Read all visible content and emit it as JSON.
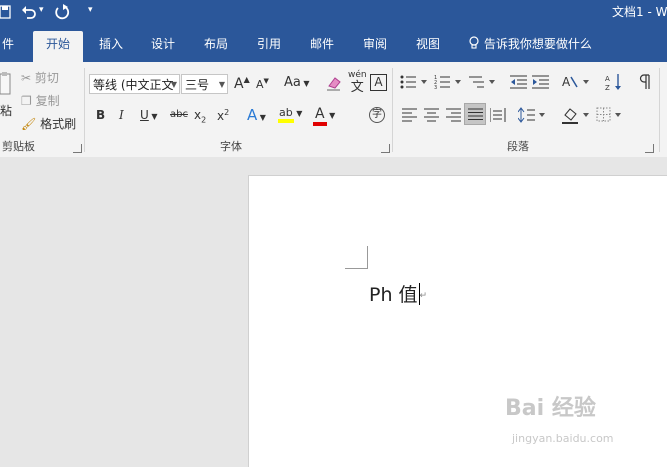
{
  "titlebar": {
    "title": "文档1 - W",
    "undo_arrow": "▾",
    "qat_more": "▾"
  },
  "tabs": [
    {
      "label": "件"
    },
    {
      "label": "开始",
      "active": true
    },
    {
      "label": "插入"
    },
    {
      "label": "设计"
    },
    {
      "label": "布局"
    },
    {
      "label": "引用"
    },
    {
      "label": "邮件"
    },
    {
      "label": "审阅"
    },
    {
      "label": "视图"
    }
  ],
  "tell_me": {
    "label": "告诉我你想要做什么"
  },
  "clipboard": {
    "paste_label": "粘",
    "cut": "剪切",
    "copy": "复制",
    "format_painter": "格式刷",
    "group_label": "剪贴板"
  },
  "font": {
    "font_name": "等线 (中文正文",
    "font_size": "三号",
    "grow": "A",
    "shrink": "A",
    "change_case": "Aa",
    "phonetic_top": "wén",
    "phonetic_bottom": "文",
    "border_char": "A",
    "bold": "B",
    "italic": "I",
    "underline": "U",
    "strikethrough": "abc",
    "subscript": "x",
    "superscript": "x",
    "subscript_mark": "2",
    "superscript_mark": "2",
    "text_effects": "A",
    "highlight": "ab",
    "font_color": "A",
    "enclose_char": "字",
    "group_label": "字体",
    "highlight_color": "#ffff00",
    "font_color_value": "#e00000"
  },
  "paragraph": {
    "group_label": "段落"
  },
  "document": {
    "text": "Ph 值",
    "paragraph_mark": "↵"
  },
  "watermark": {
    "brand": "Bai 经验",
    "url": "jingyan.baidu.com"
  },
  "colors": {
    "accent": "#2b579a",
    "ribbon": "#f3f3f3",
    "canvas": "#e6e6e6"
  }
}
